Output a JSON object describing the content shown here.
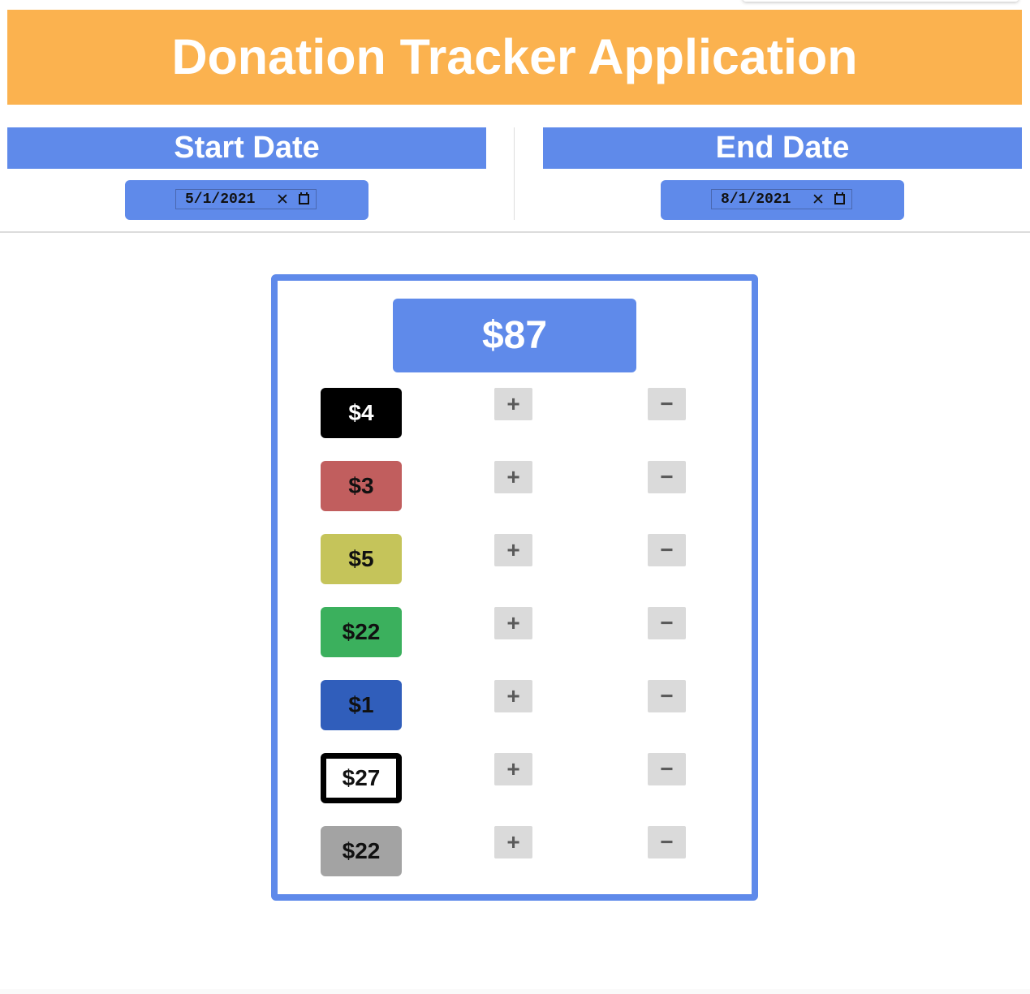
{
  "app": {
    "title": "Donation Tracker Application"
  },
  "start": {
    "label": "Start Date",
    "value": "5/1/2021",
    "clear_glyph": "✕"
  },
  "end": {
    "label": "End Date",
    "value": "8/1/2021",
    "clear_glyph": "✕"
  },
  "tracker": {
    "total": "$87",
    "plus_glyph": "+",
    "minus_glyph": "−",
    "rows": [
      {
        "amount": "$4",
        "bg": "#000000",
        "fg": "#ffffff"
      },
      {
        "amount": "$3",
        "bg": "#c15e5e",
        "fg": "#111111"
      },
      {
        "amount": "$5",
        "bg": "#c5c45a",
        "fg": "#111111"
      },
      {
        "amount": "$22",
        "bg": "#3bb05d",
        "fg": "#111111"
      },
      {
        "amount": "$1",
        "bg": "#305ebb",
        "fg": "#111111"
      },
      {
        "amount": "$27",
        "bg": "#ffffff",
        "fg": "#111111",
        "border": "#000000"
      },
      {
        "amount": "$22",
        "bg": "#a3a3a3",
        "fg": "#111111"
      }
    ]
  },
  "colors": {
    "banner": "#fbb24f",
    "accent": "#5f8aea",
    "button": "#dadada"
  }
}
